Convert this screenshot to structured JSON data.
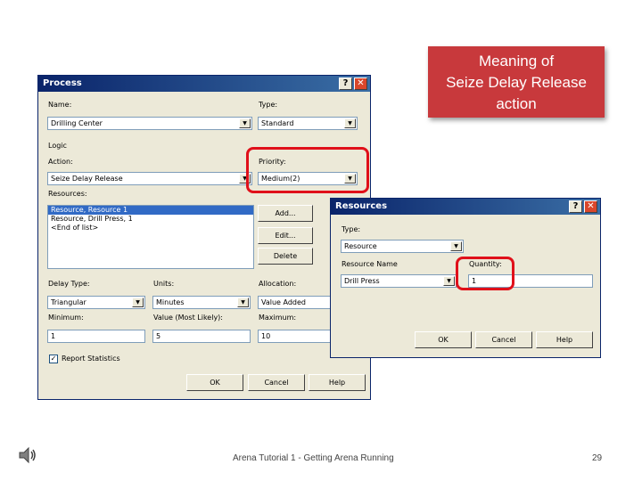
{
  "callout": {
    "line1": "Meaning of",
    "line2": "Seize Delay Release",
    "line3": "action"
  },
  "process_dialog": {
    "title": "Process",
    "help_button": "?",
    "close_button": "✕",
    "name_label": "Name:",
    "name_value": "Drilling Center",
    "type_label": "Type:",
    "type_value": "Standard",
    "logic_label": "Logic",
    "action_label": "Action:",
    "action_value": "Seize Delay Release",
    "priority_label": "Priority:",
    "priority_value": "Medium(2)",
    "resources_label": "Resources:",
    "resources_items": [
      "Resource, Resource 1",
      "Resource, Drill Press, 1",
      "<End of list>"
    ],
    "add_button": "Add...",
    "edit_button": "Edit...",
    "delete_button": "Delete",
    "delay_type_label": "Delay Type:",
    "delay_type_value": "Triangular",
    "units_label": "Units:",
    "units_value": "Minutes",
    "allocation_label": "Allocation:",
    "allocation_value": "Value Added",
    "minimum_label": "Minimum:",
    "minimum_value": "1",
    "most_likely_label": "Value (Most Likely):",
    "most_likely_value": "5",
    "maximum_label": "Maximum:",
    "maximum_value": "10",
    "report_statistics_label": "Report Statistics",
    "report_statistics_checked": "✓",
    "ok_button": "OK",
    "cancel_button": "Cancel",
    "help_button_bottom": "Help"
  },
  "resources_dialog": {
    "title": "Resources",
    "help_button": "?",
    "close_button": "✕",
    "type_label": "Type:",
    "type_value": "Resource",
    "resource_name_label": "Resource Name",
    "resource_name_value": "Drill Press",
    "quantity_label": "Quantity:",
    "quantity_value": "1",
    "ok_button": "OK",
    "cancel_button": "Cancel",
    "help_button_bottom": "Help"
  },
  "footer": {
    "text": "Arena Tutorial 1 - Getting Arena Running",
    "page": "29"
  },
  "colors": {
    "highlight": "#e0101a",
    "callout": "#c8393c",
    "titlebar": "#0a246a"
  }
}
